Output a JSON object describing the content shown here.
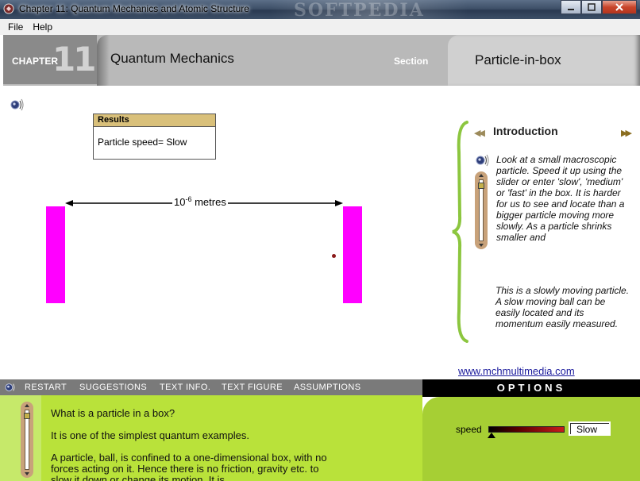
{
  "window": {
    "title": "Chapter 11:  Quantum Mechanics and Atomic Structure",
    "watermark": "SOFTPEDIA"
  },
  "menu": [
    "File",
    "Help"
  ],
  "header": {
    "chapter_label": "CHAPTER",
    "chapter_number": "11",
    "module_title": "Quantum Mechanics",
    "section_label": "Section",
    "topic_title": "Particle-in-box"
  },
  "results": {
    "heading": "Results",
    "particle_speed": "Particle speed= Slow"
  },
  "simulation": {
    "dimension_base": "10",
    "dimension_exponent": "-6",
    "dimension_unit": " metres"
  },
  "intro": {
    "title": "Introduction",
    "paragraph1": "Look at a small macroscopic particle. Speed it up using the slider or enter 'slow', 'medium' or 'fast' in the box. It is harder for us to see and locate than a bigger particle moving more slowly.  As a particle shrinks smaller and",
    "paragraph2": "This is a slowly moving particle. A slow moving ball can be easily located and its momentum easily measured.",
    "website": "www.mchmultimedia.com"
  },
  "toolbar": {
    "restart": "RESTART",
    "suggestions": "SUGGESTIONS",
    "text_info": "TEXT INFO.",
    "text_figure": "TEXT FIGURE",
    "assumptions": "ASSUMPTIONS"
  },
  "options": {
    "heading": "OPTIONS",
    "speed_label": "speed",
    "speed_value": "Slow"
  },
  "lower": {
    "question": "What is a particle in a box?",
    "answer1": "It is one of the simplest quantum examples.",
    "answer2": "A particle, ball, is confined to a one-dimensional box, with no forces acting on it.  Hence there is no friction, gravity etc. to slow it down or change its motion.  It is"
  }
}
